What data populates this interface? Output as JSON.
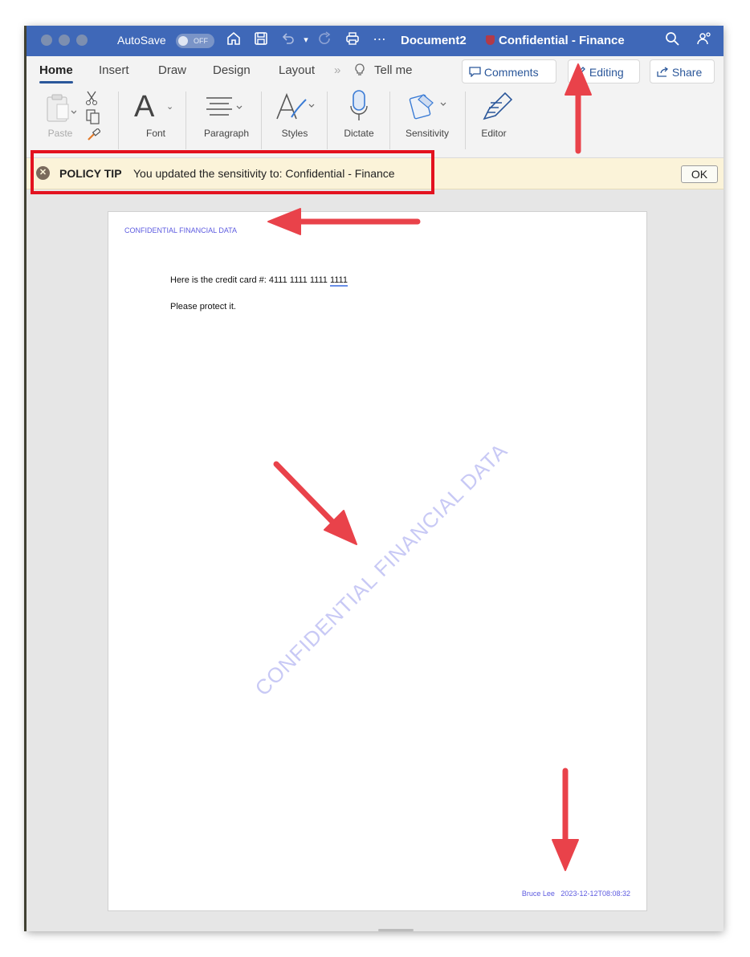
{
  "titlebar": {
    "autosave_label": "AutoSave",
    "autosave_state": "OFF",
    "document_name": "Document2",
    "sensitivity_title": "Confidential - Finance",
    "icons": [
      "home-icon",
      "save-icon",
      "undo-icon",
      "redo-icon",
      "print-icon",
      "more-icon",
      "search-icon",
      "share-people-icon"
    ]
  },
  "tabs": {
    "home": "Home",
    "insert": "Insert",
    "draw": "Draw",
    "design": "Design",
    "layout": "Layout",
    "tell_me": "Tell me",
    "comments": "Comments",
    "editing": "Editing",
    "share": "Share"
  },
  "ribbon": {
    "paste": "Paste",
    "font": "Font",
    "paragraph": "Paragraph",
    "styles": "Styles",
    "dictate": "Dictate",
    "sensitivity": "Sensitivity",
    "editor": "Editor"
  },
  "policy_bar": {
    "tip_label": "POLICY TIP",
    "message": "You updated the sensitivity to: Confidential - Finance",
    "ok_label": "OK"
  },
  "document": {
    "header": "CONFIDENTIAL FINANCIAL DATA",
    "line1_prefix": "Here is the credit card #: 4111 1111 1111 ",
    "line1_underlined": "1111",
    "line2": "Please protect it.",
    "watermark": "CONFIDENTIAL FINANCIAL DATA",
    "footer_author": "Bruce Lee",
    "footer_timestamp": "2023-12-12T08:08:32"
  },
  "colors": {
    "titlebar": "#3f68b8",
    "accent": "#2b579a",
    "policy_bg": "#fbf3d9",
    "label_text": "#5d5be0",
    "annotation_red": "#e3121f"
  }
}
